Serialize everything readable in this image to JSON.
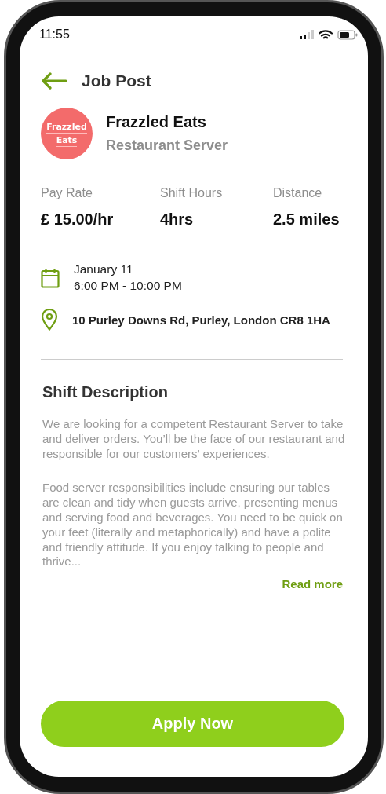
{
  "status_bar": {
    "time": "11:55"
  },
  "header": {
    "title": "Job Post"
  },
  "employer": {
    "logo_lines": [
      "Frazzled",
      "Eats"
    ],
    "name": "Frazzled Eats",
    "role": "Restaurant Server"
  },
  "stats": [
    {
      "label": "Pay Rate",
      "value": "£ 15.00/hr"
    },
    {
      "label": "Shift Hours",
      "value": "4hrs"
    },
    {
      "label": "Distance",
      "value": "2.5 miles"
    }
  ],
  "details": [
    {
      "kind": "date",
      "lines": [
        "January 11",
        "6:00 PM - 10:00 PM"
      ]
    },
    {
      "kind": "location",
      "lines": [
        "10 Purley Downs Rd, Purley, London CR8 1HA"
      ]
    }
  ],
  "description": {
    "heading": "Shift Description",
    "paragraphs": [
      "We are looking for a competent Restaurant Server to take and deliver orders. You’ll be the face of our restaurant and responsible for our customers’ experiences.",
      "Food server responsibilities include ensuring our tables are clean and tidy when guests arrive, presenting menus and serving food and beverages. You need to be quick on your feet (literally and metaphorically) and have a polite and friendly attitude. If you enjoy talking to people and thrive..."
    ],
    "read_more": "Read more"
  },
  "apply_button": "Apply Now"
}
